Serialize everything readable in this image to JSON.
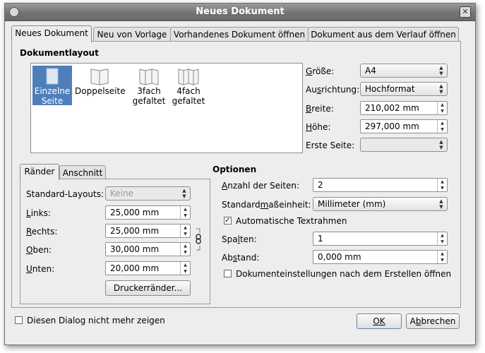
{
  "window": {
    "title": "Neues Dokument"
  },
  "tabs": [
    "Neues Dokument",
    "Neu von Vorlage",
    "Vorhandenes Dokument öffnen",
    "Dokument aus dem Verlauf öffnen"
  ],
  "layout": {
    "group_title": "Dokumentlayout",
    "items": [
      {
        "line1": "Einzelne",
        "line2": "Seite",
        "icon": "single-page-icon"
      },
      {
        "line1": "Doppelseite",
        "line2": "",
        "icon": "double-page-icon"
      },
      {
        "line1": "3fach",
        "line2": "gefaltet",
        "icon": "threefold-icon"
      },
      {
        "line1": "4fach",
        "line2": "gefaltet",
        "icon": "fourfold-icon"
      }
    ],
    "size_label": "Größe:",
    "size_value": "A4",
    "orientation_label": "Ausrichtung:",
    "orientation_value": "Hochformat",
    "width_label": "Breite:",
    "width_value": "210,002 mm",
    "height_label": "Höhe:",
    "height_value": "297,000 mm",
    "first_page_label": "Erste Seite:",
    "first_page_value": ""
  },
  "margins": {
    "tabs": [
      "Ränder",
      "Anschnitt"
    ],
    "std_layouts_label": "Standard-Layouts:",
    "std_layouts_value": "Keine",
    "left_label": "Links:",
    "left_value": "25,000 mm",
    "right_label": "Rechts:",
    "right_value": "25,000 mm",
    "top_label": "Oben:",
    "top_value": "30,000 mm",
    "bottom_label": "Unten:",
    "bottom_value": "20,000 mm",
    "printer_margins_button": "Druckerränder..."
  },
  "options": {
    "title": "Optionen",
    "pages_label": "Anzahl der Seiten:",
    "pages_value": "2",
    "unit_label": "Standardmaßeinheit:",
    "unit_value": "Millimeter (mm)",
    "auto_frames_label": "Automatische Textrahmen",
    "auto_frames_checked": true,
    "columns_label": "Spalten:",
    "columns_value": "1",
    "gap_label": "Abstand:",
    "gap_value": "0,000 mm",
    "open_settings_label": "Dokumenteinstellungen nach dem Erstellen öffnen",
    "open_settings_checked": false
  },
  "footer": {
    "dont_show_label": "Diesen Dialog nicht mehr zeigen",
    "ok_label": "OK",
    "cancel_label": "Abbrechen"
  },
  "colors": {
    "selection": "#4f7fb9",
    "window_bg": "#ededeb",
    "titlebar": "#737373"
  }
}
